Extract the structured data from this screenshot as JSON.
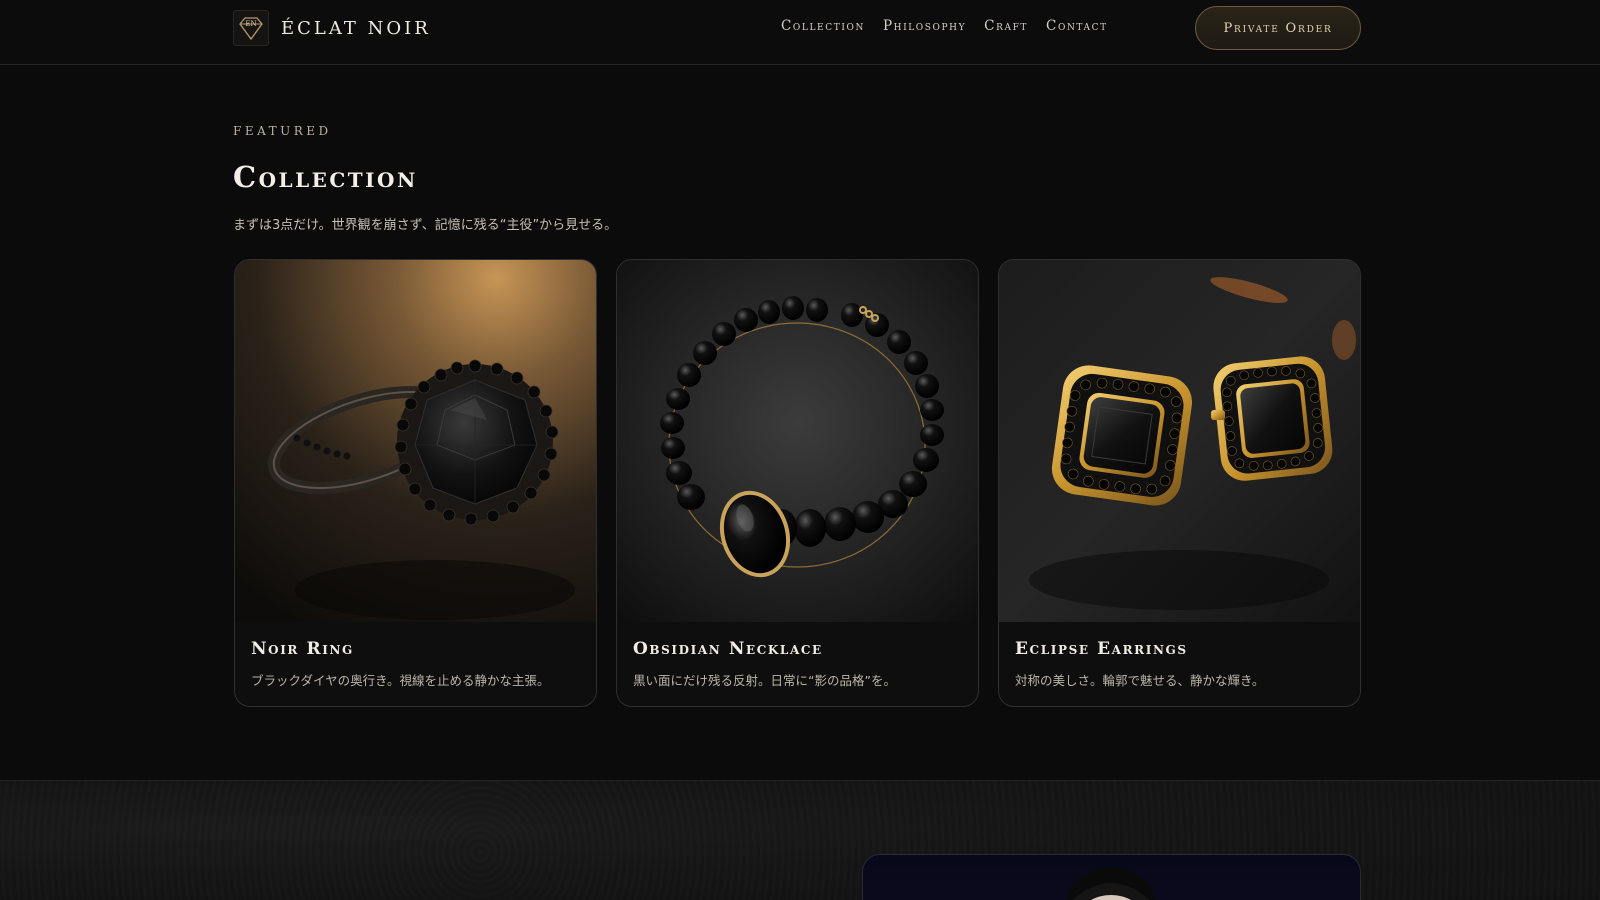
{
  "header": {
    "brand_name": "ÉCLAT NOIR",
    "logo_monogram": "EN",
    "nav": [
      "Collection",
      "Philosophy",
      "Craft",
      "Contact"
    ],
    "cta_label": "Private Order"
  },
  "featured": {
    "eyebrow": "FEATURED",
    "title": "Collection",
    "subtitle": "まずは3点だけ。世界観を崩さず、記憶に残る“主役”から見せる。"
  },
  "cards": [
    {
      "title": "Noir Ring",
      "description": "ブラックダイヤの奥行き。視線を止める静かな主張。",
      "image_subject": "black-diamond-ring"
    },
    {
      "title": "Obsidian Necklace",
      "description": "黒い面にだけ残る反射。日常に“影の品格”を。",
      "image_subject": "obsidian-bead-necklace"
    },
    {
      "title": "Eclipse Earrings",
      "description": "対称の美しさ。輪郭で魅せる、静かな輝き。",
      "image_subject": "gold-black-stud-earrings"
    }
  ],
  "colors": {
    "background": "#0b0b0b",
    "accent_gold": "#c9a35a",
    "text": "#e8e4dc"
  }
}
